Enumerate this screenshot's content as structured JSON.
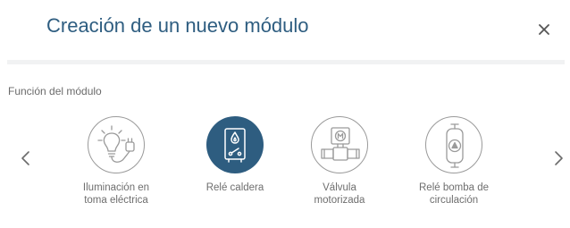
{
  "dialog": {
    "title": "Creación de un nuevo módulo",
    "close_icon": "close-icon"
  },
  "section": {
    "label": "Función del módulo"
  },
  "carousel": {
    "prev_icon": "chevron-left-icon",
    "next_icon": "chevron-right-icon",
    "selected_index": 1,
    "items": [
      {
        "label": "Iluminación en\ntoma eléctrica",
        "icon": "lightbulb-plug-icon",
        "selected": false
      },
      {
        "label": "Relé caldera",
        "icon": "boiler-relay-icon",
        "selected": true
      },
      {
        "label": "Válvula\nmotorizada",
        "icon": "motorized-valve-icon",
        "selected": false
      },
      {
        "label": "Relé bomba de\ncirculación",
        "icon": "circulation-pump-icon",
        "selected": false
      }
    ]
  },
  "colors": {
    "accent": "#2e5d80",
    "icon_gray": "#9a9a9a",
    "text_gray": "#6e6e6e",
    "divider": "#f1f2f3"
  }
}
